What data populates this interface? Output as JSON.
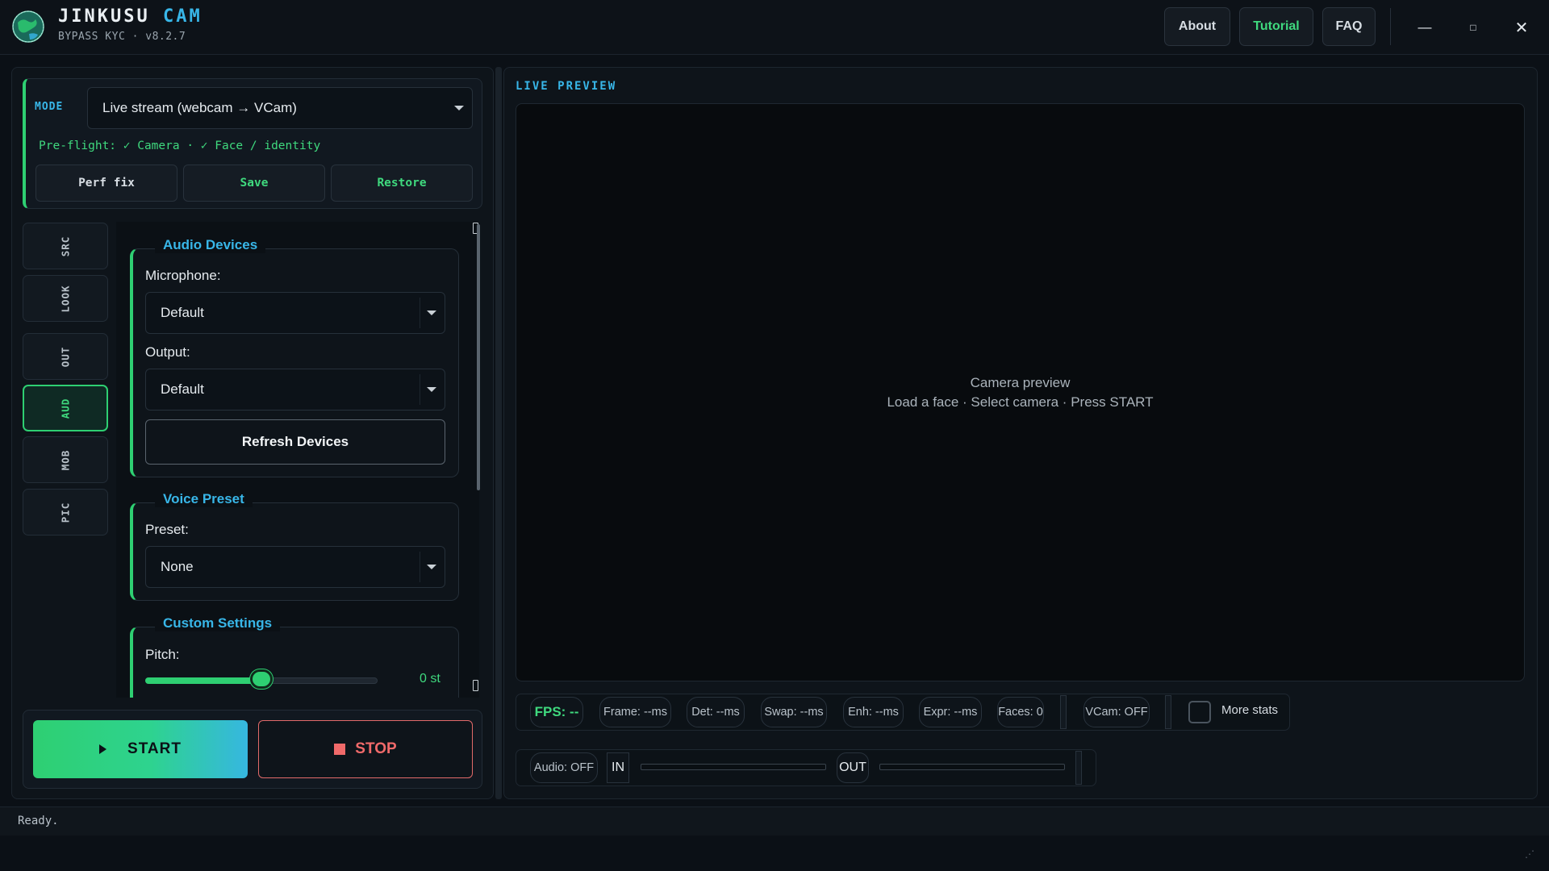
{
  "app": {
    "name_main": "JINKUSU",
    "name_accent": "CAM",
    "subtitle": "BYPASS KYC · v8.2.7"
  },
  "header": {
    "about": "About",
    "tutorial": "Tutorial",
    "faq": "FAQ"
  },
  "window": {
    "minimize": "—",
    "maximize": "□",
    "close": "✕"
  },
  "mode": {
    "label": "MODE",
    "value": "Live stream (webcam → VCam)",
    "preflight": "Pre-flight: ✓ Camera · ✓ Face / identity",
    "buttons": [
      "Perf fix",
      "Save",
      "Restore"
    ]
  },
  "side_tabs": [
    "SRC",
    "LOOK",
    "OUT",
    "AUD",
    "MOB",
    "PIC"
  ],
  "active_tab": "AUD",
  "audio_devices": {
    "title": "Audio Devices",
    "mic_label": "Microphone:",
    "mic_value": "Default",
    "output_label": "Output:",
    "output_value": "Default",
    "refresh": "Refresh Devices"
  },
  "voice_preset": {
    "title": "Voice Preset",
    "preset_label": "Preset:",
    "preset_value": "None"
  },
  "custom_settings": {
    "title": "Custom Settings",
    "pitch_label": "Pitch:",
    "pitch_value": "0 st",
    "pitch_level": 0.5
  },
  "actions": {
    "start": "START",
    "stop": "STOP"
  },
  "preview": {
    "title": "LIVE PREVIEW",
    "line1": "Camera preview",
    "line2": "Load a face  ·  Select camera  ·  Press START"
  },
  "stats": {
    "fps": "FPS: --",
    "frame": "Frame: --ms",
    "det": "Det: --ms",
    "swap": "Swap: --ms",
    "enh": "Enh: --ms",
    "expr": "Expr: --ms",
    "faces": "Faces: 0",
    "vcam": "VCam: OFF",
    "more": "More stats"
  },
  "audio_bar": {
    "status": "Audio: OFF",
    "in": "IN",
    "out": "OUT"
  },
  "status": {
    "text": "Ready."
  },
  "colors": {
    "accent_green": "#2ecf72",
    "accent_blue": "#38b6e8",
    "stop_red": "#f06a6a",
    "background": "#0b1016"
  }
}
